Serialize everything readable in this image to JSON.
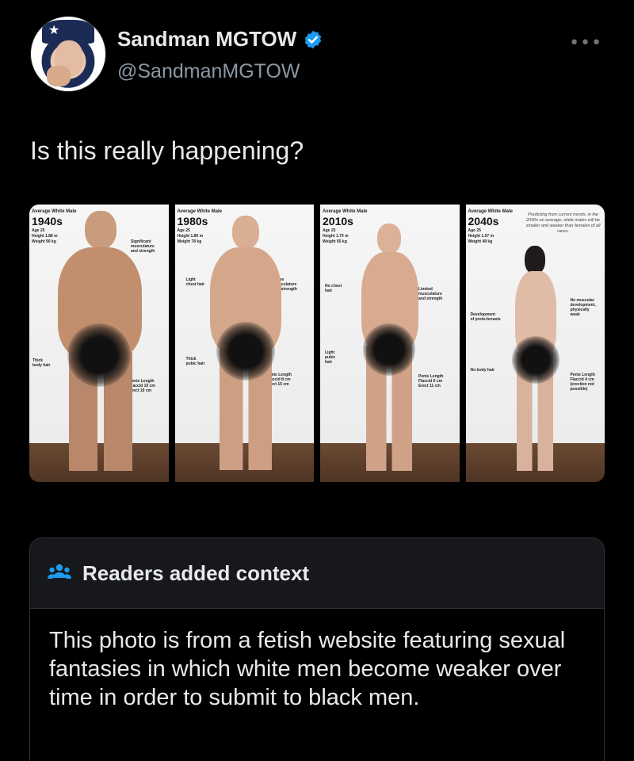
{
  "author": {
    "name": "Sandman MGTOW",
    "handle": "@SandmanMGTOW",
    "verified": true,
    "avatar": "uncle-sam-pointing-woman-avatar"
  },
  "icons": {
    "more": "more-horizontal-icon",
    "verified": "verified-badge-icon",
    "people": "people-icon"
  },
  "colors": {
    "verified": "#1d9bf0",
    "background": "#000000",
    "muted_text": "#8b98a5",
    "context_header": "#16181c"
  },
  "tweet": {
    "text": "Is this really happening?"
  },
  "media": {
    "panels": [
      {
        "caption": "Average White Male",
        "era": "1940s",
        "stats": "Age 25\nHeight 1.88 m\nWeight 90 kg",
        "notes": [
          "Significant\nmusculature\nand strength",
          "Thick\nbody hair",
          "Penis Length\nFlaccid 10 cm\nErect 19 cm"
        ]
      },
      {
        "caption": "Average White Male",
        "era": "1980s",
        "stats": "Age 25\nHeight 1.80 m\nWeight 78 kg",
        "notes": [
          "Light\nchest hair",
          "Some\nmusculature\nand strength",
          "Thick\npubic hair",
          "Penis Length\nFlaccid 8 cm\nErect 15 cm"
        ]
      },
      {
        "caption": "Average White Male",
        "era": "2010s",
        "stats": "Age 25\nHeight 1.70 m\nWeight 65 kg",
        "notes": [
          "No chest\nhair",
          "Limited\nmusculature\nand strength",
          "Light\npubic\nhair",
          "Penis Length\nFlaccid 6 cm\nErect 11 cm"
        ]
      },
      {
        "caption": "Average White Male",
        "era": "2040s",
        "stats": "Age 25\nHeight 1.57 m\nWeight 48 kg",
        "prediction": "Predicting from current trends, in the 2040s on average, white males will be smaller and weaker than females of all races.",
        "notes": [
          "Development\nof proto-breasts",
          "No muscular\ndevelopment,\nphysically\nweak",
          "No body hair",
          "Penis Length\nFlaccid 4 cm\n(erection not\npossible)"
        ]
      }
    ]
  },
  "context": {
    "title": "Readers added context",
    "body": "This photo is from a fetish website featuring sexual fantasies in which white men become weaker over time in order to submit to black men."
  }
}
